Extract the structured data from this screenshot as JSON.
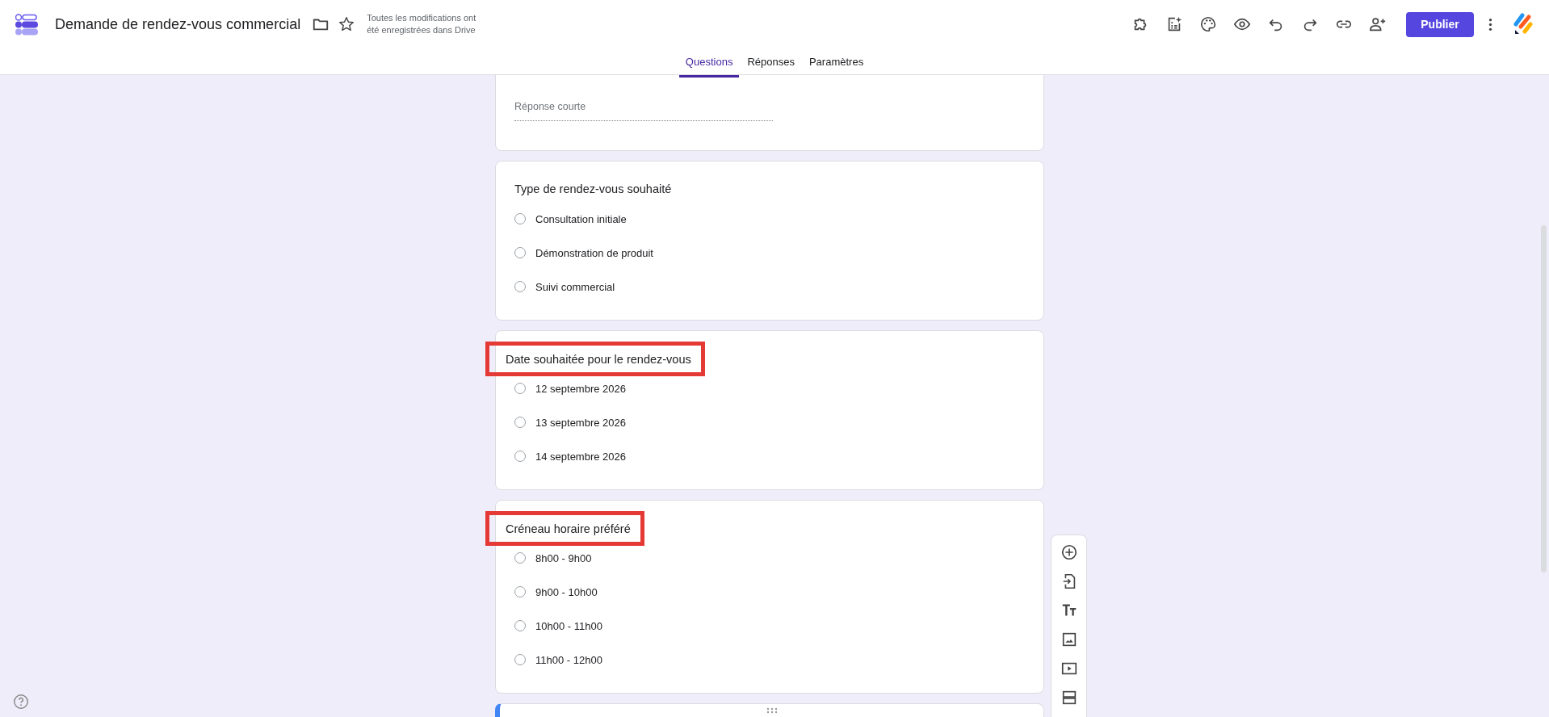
{
  "header": {
    "title": "Demande de rendez-vous commercial",
    "save_status": "Toutes les modifications ont été enregistrées dans Drive",
    "publish_button": "Publier"
  },
  "tabs": [
    {
      "label": "Questions",
      "selected": true
    },
    {
      "label": "Réponses",
      "selected": false
    },
    {
      "label": "Paramètres",
      "selected": false
    }
  ],
  "questions": [
    {
      "kind": "short",
      "placeholder": "Réponse courte"
    },
    {
      "kind": "choice",
      "title": "Type de rendez-vous souhaité",
      "highlighted": false,
      "options": [
        {
          "label": "Consultation initiale",
          "selected": false
        },
        {
          "label": "Démonstration de produit",
          "selected": false
        },
        {
          "label": "Suivi commercial",
          "selected": false
        }
      ]
    },
    {
      "kind": "choice",
      "title": "Date souhaitée pour le rendez-vous",
      "highlighted": true,
      "options": [
        {
          "label": "12 septembre 2026",
          "selected": false
        },
        {
          "label": "13 septembre 2026",
          "selected": false
        },
        {
          "label": "14 septembre 2026",
          "selected": false
        }
      ]
    },
    {
      "kind": "choice",
      "title": "Créneau horaire préféré",
      "highlighted": true,
      "options": [
        {
          "label": "8h00 - 9h00",
          "selected": false
        },
        {
          "label": "9h00 - 10h00",
          "selected": false
        },
        {
          "label": "10h00 - 11h00",
          "selected": false
        },
        {
          "label": "11h00 - 12h00",
          "selected": false
        }
      ]
    },
    {
      "kind": "active"
    }
  ]
}
